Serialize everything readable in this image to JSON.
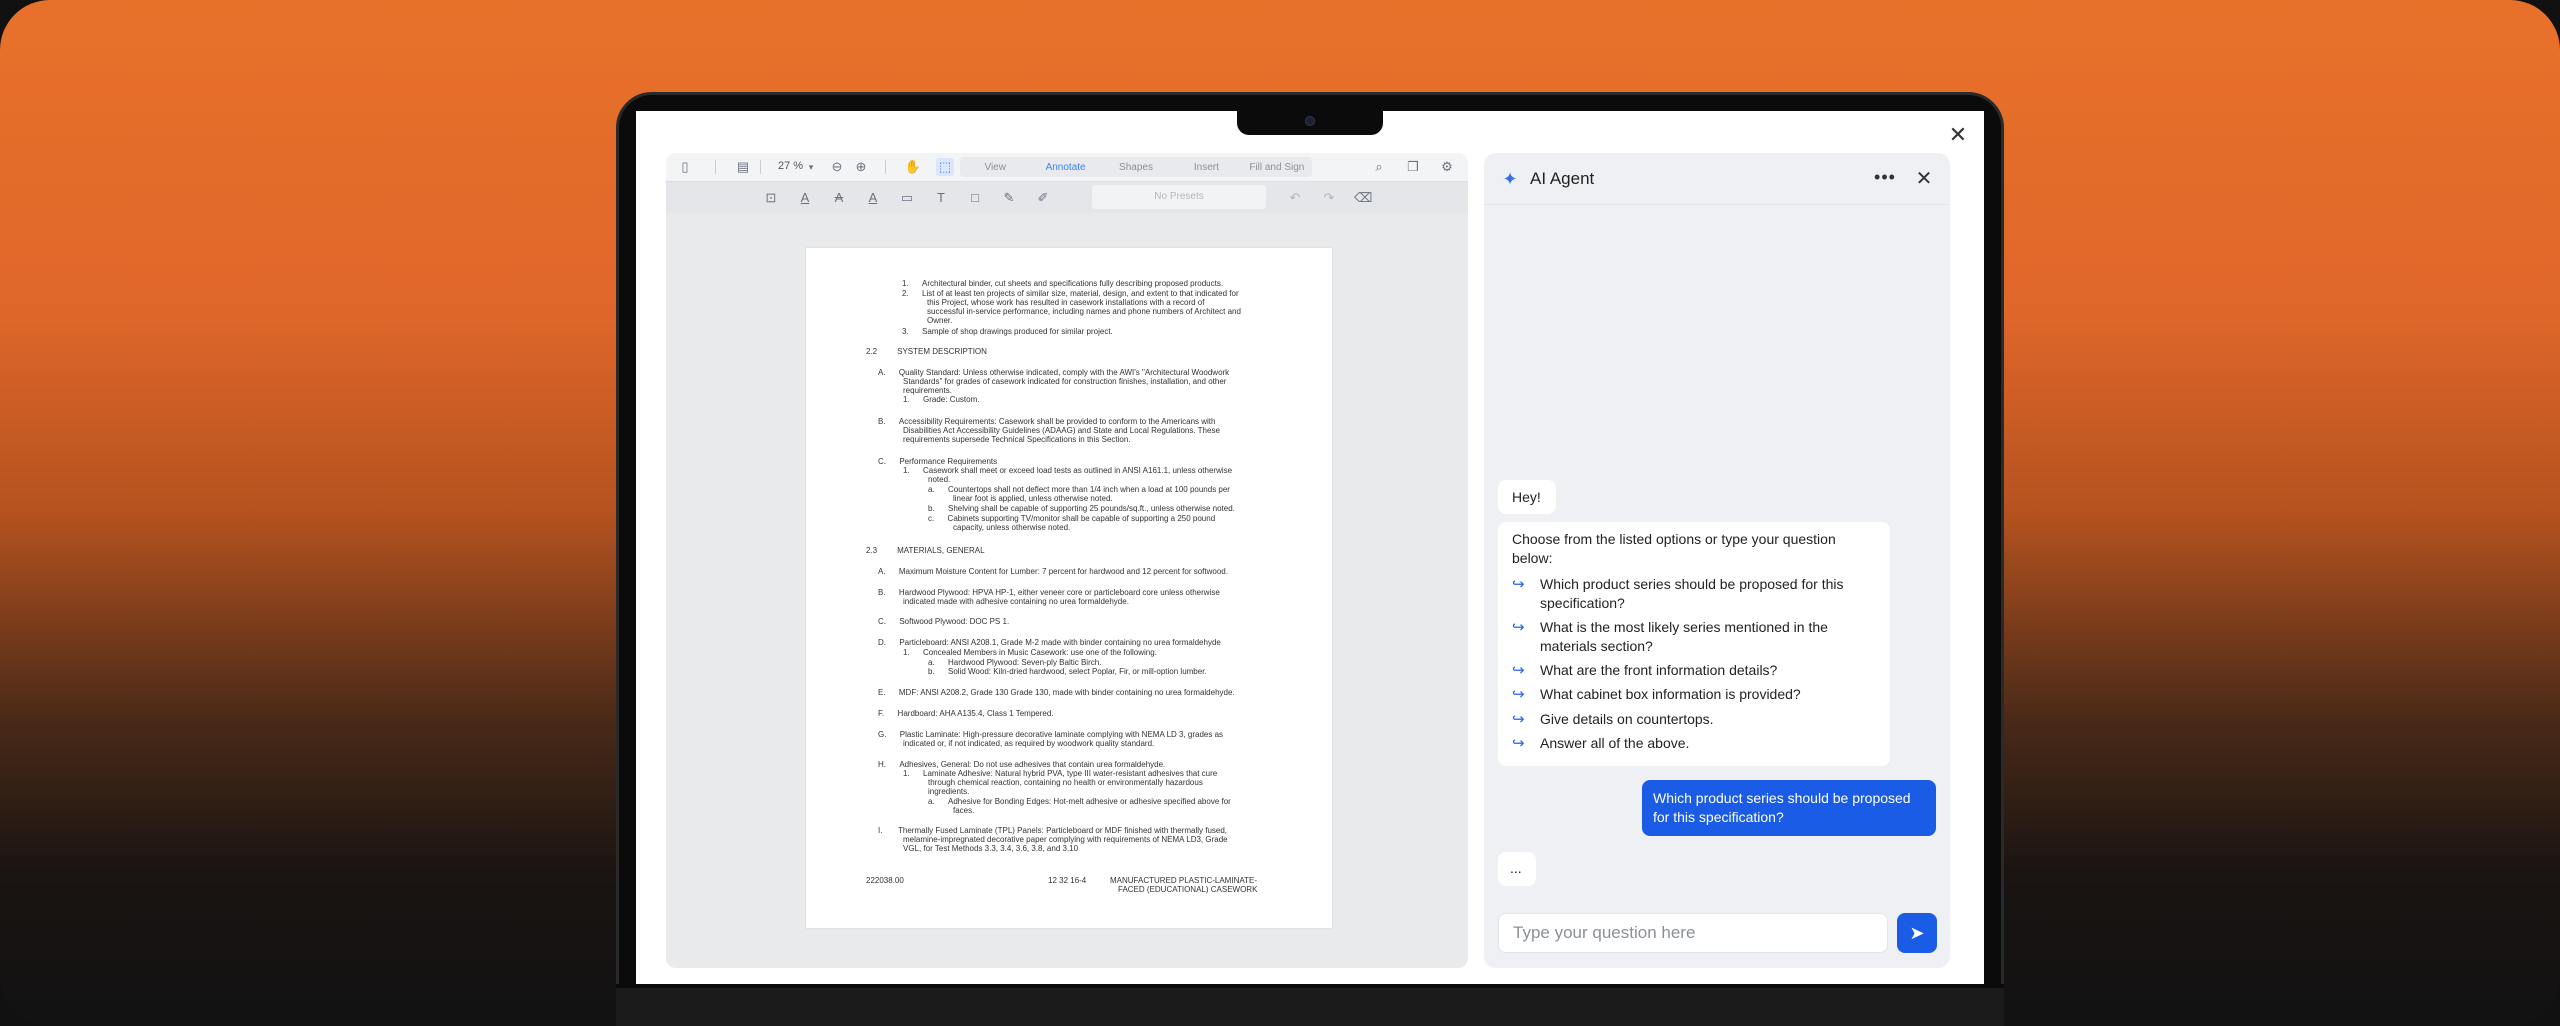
{
  "toolbar": {
    "zoom": "27 %",
    "tabs": [
      "View",
      "Annotate",
      "Shapes",
      "Insert",
      "Fill and Sign"
    ],
    "presets": "No Presets"
  },
  "document": {
    "lines": [
      "1.      Architectural binder, cut sheets and specifications fully describing proposed products.",
      "2.      List of at least ten projects of similar size, material, design, and extent to that indicated for",
      "this Project, whose work has resulted in casework installations with a record of",
      "successful in-service performance, including names and phone numbers of Architect and",
      "Owner.",
      "3.      Sample of shop drawings produced for similar project.",
      "2.2         SYSTEM DESCRIPTION",
      "A.      Quality Standard:  Unless otherwise indicated, comply with the AWI's \"Architectural Woodwork",
      "Standards\" for grades of casework indicated for construction finishes, installation, and other",
      "requirements.",
      "1.      Grade:  Custom.",
      "B.      Accessibility Requirements:  Casework shall be provided to conform to the Americans with",
      "Disabilities Act Accessibility Guidelines (ADAAG) and State and Local Regulations.   These",
      "requirements supersede Technical Specifications in this Section.",
      "C.      Performance Requirements",
      "1.      Casework shall meet or exceed load tests as outlined in ANSI A161.1, unless otherwise",
      "noted.",
      "a.      Countertops shall not deflect more than 1/4 inch when a load at 100 pounds per",
      "linear foot is applied, unless otherwise noted.",
      "b.      Shelving shall be capable of supporting 25 pounds/sq.ft., unless otherwise noted.",
      "c.      Cabinets supporting TV/monitor shall be capable of supporting a 250 pound",
      "capacity, unless otherwise noted.",
      "2.3         MATERIALS, GENERAL",
      "A.      Maximum Moisture Content for Lumber:  7 percent for hardwood and 12 percent for softwood.",
      "B.      Hardwood Plywood:  HPVA HP-1, either veneer core or particleboard core unless otherwise",
      "indicated made with adhesive containing no urea formaldehyde.",
      "C.      Softwood Plywood:  DOC PS 1.",
      "D.      Particleboard:  ANSI A208.1, Grade M-2 made with binder containing no urea formaldehyde",
      "1.      Concealed Members in Music Casework:  use one of the following.",
      "a.      Hardwood Plywood:  Seven-ply Baltic Birch.",
      "b.      Solid Wood:  Kiln-dried hardwood, select Poplar, Fir, or mill-option lumber.",
      "E.      MDF:  ANSI A208.2, Grade 130 Grade 130, made with binder containing no urea formaldehyde.",
      "F.      Hardboard:  AHA A135.4, Class 1 Tempered.",
      "G.      Plastic Laminate:  High-pressure decorative laminate complying with NEMA LD 3, grades as",
      "indicated or, if not indicated, as required by woodwork quality standard.",
      "H.      Adhesives, General:  Do not use adhesives that contain urea formaldehyde.",
      "1.      Laminate Adhesive:  Natural hybrid PVA, type III water-resistant adhesives that cure",
      "through chemical reaction, containing no health or environmentally hazardous",
      "ingredients.",
      "a.      Adhesive for Bonding Edges:  Hot-melt adhesive or adhesive specified above for",
      "faces.",
      "I.       Thermally Fused Laminate (TPL) Panels:  Particleboard or MDF finished with thermally fused,",
      "melamine-impregnated decorative paper complying with requirements of NEMA LD3, Grade",
      "VGL, for Test Methods 3.3, 3.4, 3.6, 3.8, and 3.10"
    ],
    "footer_left": "222038.00",
    "footer_mid": "12 32 16-4",
    "footer_right_1": "MANUFACTURED PLASTIC-LAMINATE-",
    "footer_right_2": "FACED (EDUCATIONAL) CASEWORK"
  },
  "agent": {
    "title": "AI Agent",
    "greeting": "Hey!",
    "prompt": "Choose from the listed options or type your question below:",
    "options": [
      "Which product series should be proposed for this specification?",
      "What is the most likely series mentioned in the materials section?",
      "What are the front information details?",
      "What cabinet box information is provided?",
      "Give details on countertops.",
      "Answer all of the above."
    ],
    "user_message": "Which product series should be proposed for this specification?",
    "typing": "...",
    "input_placeholder": "Type your question here"
  },
  "colors": {
    "accent": "#1a5ce6",
    "background_top": "#e8712a"
  }
}
